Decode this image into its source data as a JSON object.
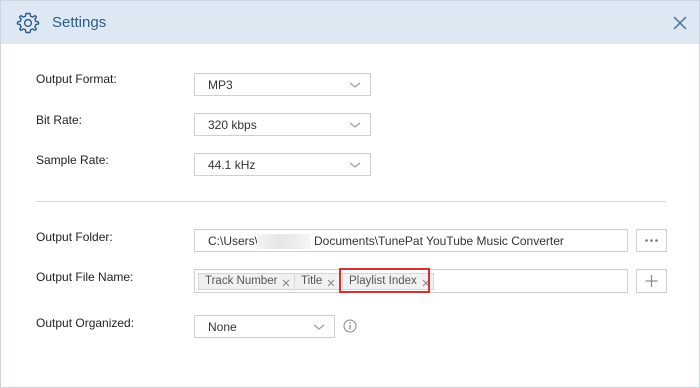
{
  "header": {
    "title": "Settings",
    "icon": "gear-icon",
    "close_icon": "close-icon"
  },
  "settings": {
    "output_format": {
      "label": "Output Format:",
      "value": "MP3"
    },
    "bit_rate": {
      "label": "Bit Rate:",
      "value": "320 kbps"
    },
    "sample_rate": {
      "label": "Sample Rate:",
      "value": "44.1 kHz"
    },
    "output_folder": {
      "label": "Output Folder:",
      "path_start": "C:\\Users\\",
      "path_end": "Documents\\TunePat YouTube Music Converter",
      "browse_icon": "ellipsis-icon"
    },
    "output_file_name": {
      "label": "Output File Name:",
      "tags": [
        "Track Number",
        "Title",
        "Playlist Index"
      ],
      "add_icon": "plus-icon"
    },
    "output_organized": {
      "label": "Output Organized:",
      "value": "None",
      "info_icon": "info-icon"
    }
  },
  "colors": {
    "titlebar_bg": "#dde8f3",
    "title_text": "#2b5d8c",
    "highlight_border": "#d9302b"
  }
}
